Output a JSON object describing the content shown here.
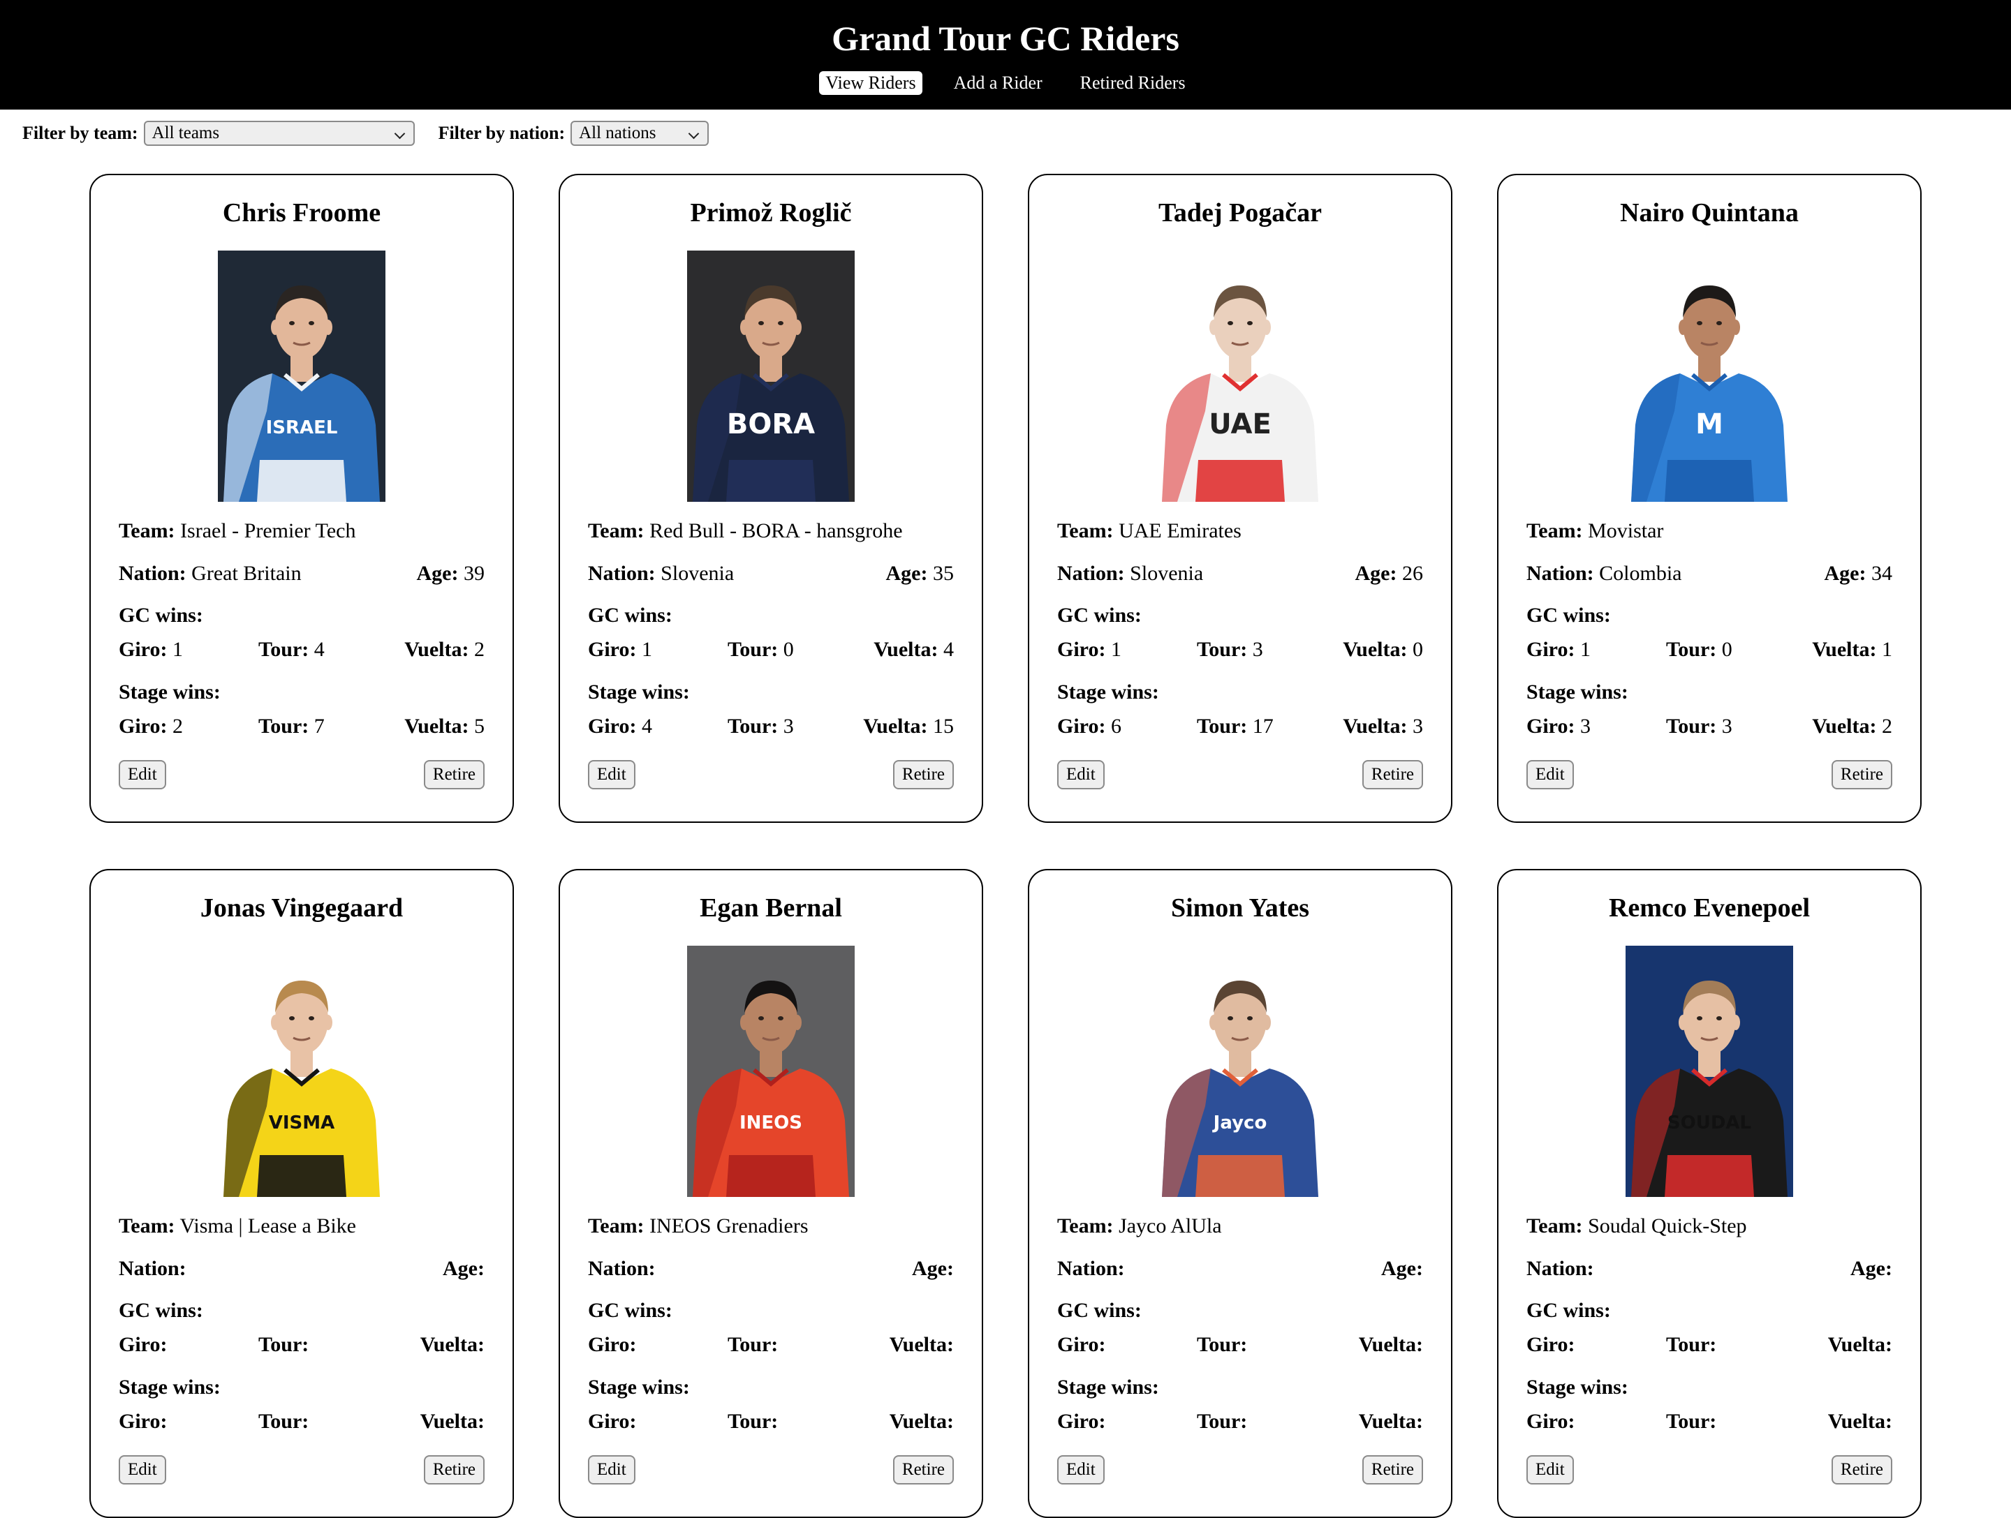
{
  "header": {
    "title": "Grand Tour GC Riders",
    "nav": [
      "View Riders",
      "Add a Rider",
      "Retired Riders"
    ]
  },
  "filters": {
    "team_label": "Filter by team:",
    "team_value": "All teams",
    "nation_label": "Filter by nation:",
    "nation_value": "All nations"
  },
  "labels": {
    "team": "Team:",
    "nation": "Nation:",
    "age": "Age:",
    "gc_wins": "GC wins:",
    "stage_wins": "Stage wins:",
    "giro": "Giro:",
    "tour": "Tour:",
    "vuelta": "Vuelta:",
    "edit": "Edit",
    "retire": "Retire"
  },
  "riders": [
    {
      "name": "Chris Froome",
      "team": "Israel - Premier Tech",
      "nation": "Great Britain",
      "age": "39",
      "gc": {
        "giro": "1",
        "tour": "4",
        "vuelta": "2"
      },
      "stages": {
        "giro": "2",
        "tour": "7",
        "vuelta": "5"
      },
      "photo": {
        "bg": "#1f2936",
        "kit": "#2b6db8",
        "kit2": "#f1f4f8",
        "text": "ISRAEL",
        "text_color": "#ffffff",
        "skin": "#e2b79a",
        "hair": "#2a2522"
      }
    },
    {
      "name": "Primož Roglič",
      "team": "Red Bull - BORA - hansgrohe",
      "nation": "Slovenia",
      "age": "35",
      "gc": {
        "giro": "1",
        "tour": "0",
        "vuelta": "4"
      },
      "stages": {
        "giro": "4",
        "tour": "3",
        "vuelta": "15"
      },
      "photo": {
        "bg": "#2c2c2e",
        "kit": "#1a2540",
        "kit2": "#22305a",
        "text": "BORA",
        "text_color": "#ffffff",
        "skin": "#d9a98a",
        "hair": "#4a3a2c"
      }
    },
    {
      "name": "Tadej Pogačar",
      "team": "UAE Emirates",
      "nation": "Slovenia",
      "age": "26",
      "gc": {
        "giro": "1",
        "tour": "3",
        "vuelta": "0"
      },
      "stages": {
        "giro": "6",
        "tour": "17",
        "vuelta": "3"
      },
      "photo": {
        "bg": "#ffffff",
        "kit": "#f2f2f2",
        "kit2": "#e03131",
        "text": "UAE",
        "text_color": "#222222",
        "skin": "#ead0bd",
        "hair": "#6b5440"
      }
    },
    {
      "name": "Nairo Quintana",
      "team": "Movistar",
      "nation": "Colombia",
      "age": "34",
      "gc": {
        "giro": "1",
        "tour": "0",
        "vuelta": "1"
      },
      "stages": {
        "giro": "3",
        "tour": "3",
        "vuelta": "2"
      },
      "photo": {
        "bg": "#ffffff",
        "kit": "#2f7fd4",
        "kit2": "#1c5fb0",
        "text": "M",
        "text_color": "#ffffff",
        "skin": "#b98464",
        "hair": "#1d1a18"
      }
    },
    {
      "name": "Jonas Vingegaard",
      "team": "Visma | Lease a Bike",
      "nation": "",
      "age": "",
      "gc": {
        "giro": "",
        "tour": "",
        "vuelta": ""
      },
      "stages": {
        "giro": "",
        "tour": "",
        "vuelta": ""
      },
      "photo": {
        "bg": "#ffffff",
        "kit": "#f4d418",
        "kit2": "#141414",
        "text": "VISMA",
        "text_color": "#111111",
        "skin": "#e8c2a6",
        "hair": "#b88a4e"
      }
    },
    {
      "name": "Egan Bernal",
      "team": "INEOS Grenadiers",
      "nation": "",
      "age": "",
      "gc": {
        "giro": "",
        "tour": "",
        "vuelta": ""
      },
      "stages": {
        "giro": "",
        "tour": "",
        "vuelta": ""
      },
      "photo": {
        "bg": "#5e5e60",
        "kit": "#e5452a",
        "kit2": "#b0201c",
        "text": "INEOS",
        "text_color": "#ffffff",
        "skin": "#b88464",
        "hair": "#141212"
      }
    },
    {
      "name": "Simon Yates",
      "team": "Jayco AlUla",
      "nation": "",
      "age": "",
      "gc": {
        "giro": "",
        "tour": "",
        "vuelta": ""
      },
      "stages": {
        "giro": "",
        "tour": "",
        "vuelta": ""
      },
      "photo": {
        "bg": "#ffffff",
        "kit": "#2d4f98",
        "kit2": "#e0603a",
        "text": "Jayco",
        "text_color": "#ffffff",
        "skin": "#e0bba0",
        "hair": "#5a4433"
      }
    },
    {
      "name": "Remco Evenepoel",
      "team": "Soudal Quick-Step",
      "nation": "",
      "age": "",
      "gc": {
        "giro": "",
        "tour": "",
        "vuelta": ""
      },
      "stages": {
        "giro": "",
        "tour": "",
        "vuelta": ""
      },
      "photo": {
        "bg": "#17356e",
        "kit": "#1a1a1a",
        "kit2": "#d62b2b",
        "text": "SOUDAL",
        "text_color": "#111111",
        "skin": "#e6c0a4",
        "hair": "#a37d58"
      }
    }
  ]
}
